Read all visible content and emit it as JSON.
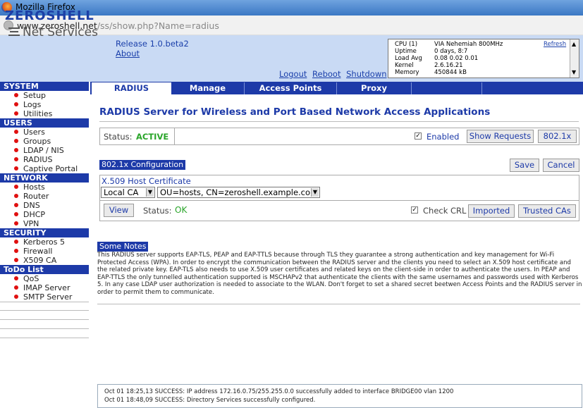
{
  "browser": {
    "window_title": "Mozilla Firefox",
    "url_domain": "www.zeroshell.net",
    "url_path": "/ss/show.php?Name=radius"
  },
  "header": {
    "logo_text": "ZEROSHELL",
    "logo_sub": "Net Services",
    "release": "Release 1.0.beta2",
    "about": "About",
    "links": [
      "Logout",
      "Reboot",
      "Shutdown"
    ],
    "sysinfo": {
      "rows": [
        {
          "k": "CPU (1)",
          "v": "VIA Nehemiah 800MHz"
        },
        {
          "k": "Uptime",
          "v": "0 days, 8:7"
        },
        {
          "k": "Load Avg",
          "v": "0.08 0.02 0.01"
        },
        {
          "k": "Kernel",
          "v": "2.6.16.21"
        },
        {
          "k": "Memory",
          "v": "450844 kB"
        }
      ],
      "refresh": "Refresh"
    }
  },
  "sidebar": {
    "sections": [
      {
        "title": "SYSTEM",
        "items": [
          "Setup",
          "Logs",
          "Utilities"
        ]
      },
      {
        "title": "USERS",
        "items": [
          "Users",
          "Groups",
          "LDAP / NIS",
          "RADIUS",
          "Captive Portal"
        ]
      },
      {
        "title": "NETWORK",
        "items": [
          "Hosts",
          "Router",
          "DNS",
          "DHCP",
          "VPN"
        ]
      },
      {
        "title": "SECURITY",
        "items": [
          "Kerberos 5",
          "Firewall",
          "X509 CA"
        ]
      },
      {
        "title": "ToDo List",
        "items": [
          "QoS",
          "IMAP Server",
          "SMTP Server"
        ]
      }
    ]
  },
  "tabs": [
    "RADIUS",
    "Manage",
    "Access Points",
    "Proxy"
  ],
  "page": {
    "title": "RADIUS Server for Wireless and Port Based Network Access Applications",
    "status_label": "Status:",
    "status_value": "ACTIVE",
    "enabled_label": "Enabled",
    "show_requests": "Show Requests",
    "dot1x_button": "802.1x",
    "config_header": "802.1x Configuration",
    "save": "Save",
    "cancel": "Cancel",
    "cert_label": "X.509 Host Certificate",
    "ca_select": "Local CA",
    "cert_select": "OU=hosts, CN=zeroshell.example.com",
    "view": "View",
    "cert_status_label": "Status:",
    "cert_status_value": "OK",
    "check_crl": "Check CRL",
    "imported": "Imported",
    "trusted_cas": "Trusted CAs",
    "notes_header": "Some Notes",
    "notes_text": "This RADIUS server supports EAP-TLS, PEAP and EAP-TTLS because through TLS they guarantee a strong authentication and key management for Wi-Fi Protected Access (WPA). In order to encrypt the communication between the RADIUS server and the clients you need to select an X.509 host certificate and the related private key. EAP-TLS also needs to use X.509 user certificates and related keys on the client-side in order to authenticate the users. In PEAP and EAP-TTLS the only tunnelled authentication supported is MSCHAPv2 that authenticate the clients with the same usernames and passwords used with Kerberos 5. In any case LDAP user authorization is needed to associate to the WLAN. Don't forget to set a shared secret beetwen Access Points and the RADIUS server in order to permit them to communicate."
  },
  "log": [
    "Oct 01 18:25,13 SUCCESS: IP address 172.16.0.75/255.255.0.0 successfully added to interface BRIDGE00 vlan 1200",
    "Oct 01 18:48,09 SUCCESS: Directory Services successfully configured."
  ]
}
